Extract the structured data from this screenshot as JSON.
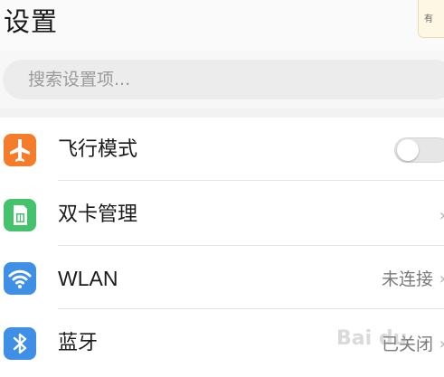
{
  "header": {
    "title": "设置"
  },
  "note_popup": {
    "text": "有"
  },
  "search": {
    "placeholder": "搜索设置项..."
  },
  "settings": {
    "items": [
      {
        "label": "飞行模式",
        "icon": "airplane-icon",
        "icon_color": "#f57c2b",
        "control": "toggle",
        "toggle_state": "off"
      },
      {
        "label": "双卡管理",
        "icon": "sim-card-icon",
        "icon_color": "#45c26c",
        "value": "",
        "chevron": "›"
      },
      {
        "label": "WLAN",
        "icon": "wifi-icon",
        "icon_color": "#3f8fe6",
        "value": "未连接",
        "chevron": "›"
      },
      {
        "label": "蓝牙",
        "icon": "bluetooth-icon",
        "icon_color": "#3f8fe6",
        "value": "已关闭",
        "chevron": "›"
      }
    ]
  },
  "watermark": {
    "text": "Bai du"
  }
}
